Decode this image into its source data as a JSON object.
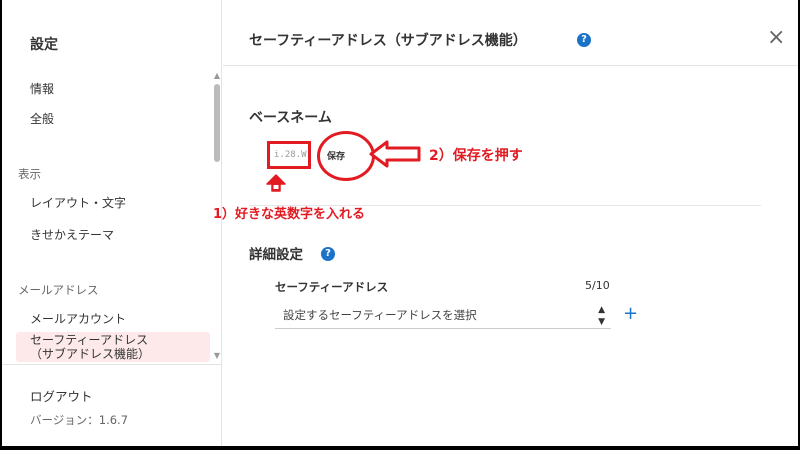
{
  "sidebar": {
    "title": "設定",
    "items": [
      {
        "label": "情報"
      },
      {
        "label": "全般"
      },
      {
        "label": "レイアウト・文字"
      },
      {
        "label": "きせかえテーマ"
      },
      {
        "label": "メールアカウント"
      },
      {
        "label": "セーフティーアドレス\n（サブアドレス機能）"
      }
    ],
    "sections": [
      "表示",
      "メールアドレス"
    ],
    "logout_label": "ログアウト",
    "version": "バージョン：1.6.7"
  },
  "header": {
    "title": "セーフティーアドレス（サブアドレス機能）",
    "help_icon": "?",
    "close_icon": "×"
  },
  "main": {
    "base_name_title": "ベースネーム",
    "base_name_value": "i.28.W",
    "save_label": "保存",
    "detail_title": "詳細設定",
    "detail_help_icon": "?",
    "safety_address_label": "セーフティーアドレス",
    "count": "5/10",
    "select_value": "設定するセーフティーアドレスを選択",
    "add_icon": "+"
  },
  "annotations": {
    "step1": "1）好きな英数字を入れる",
    "step2": "2）保存を押す"
  },
  "colors": {
    "accent": "#1a73c8",
    "annotation": "#e21b22",
    "active_bg": "#fde9ea"
  }
}
